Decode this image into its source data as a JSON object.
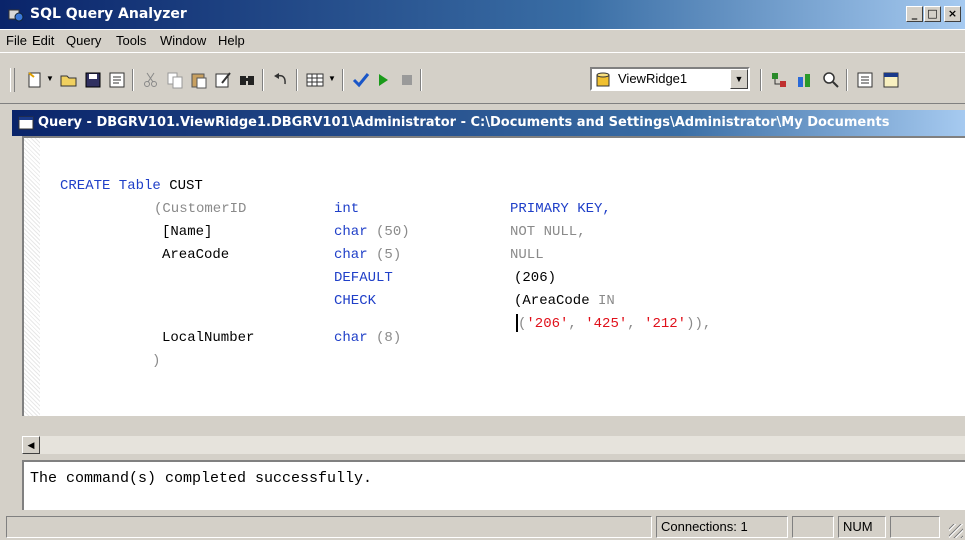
{
  "window": {
    "title": "SQL Query Analyzer",
    "minimize": "_",
    "maximize": "□",
    "close": "×"
  },
  "menu": [
    "File",
    "Edit",
    "Query",
    "Tools",
    "Window",
    "Help"
  ],
  "toolbar": {
    "database": "ViewRidge1",
    "icons": [
      "new-query-icon",
      "open-icon",
      "save-icon",
      "load-script-icon",
      "cut-icon",
      "copy-icon",
      "paste-icon",
      "clear-window-icon",
      "find-icon",
      "undo-icon",
      "results-mode-icon",
      "parse-icon",
      "execute-icon",
      "stop-icon",
      "database-icon",
      "object-browser-icon",
      "object-search-icon",
      "show-plan-icon",
      "properties-icon",
      "show-results-pane-icon"
    ]
  },
  "child_window": {
    "title": "Query - DBGRV101.ViewRidge1.DBGRV101\\Administrator - C:\\Documents and Settings\\Administrator\\My Documents"
  },
  "editor": {
    "lines": {
      "l1_kw": "CREATE Table",
      "l1_rest": " CUST",
      "c_customer": "(CustomerID",
      "c_name": "[Name]",
      "c_areacode": "AreaCode",
      "c_local": "LocalNumber",
      "c_close": ")",
      "t_int": "int",
      "t_char50_kw": "char",
      "t_char50_num": " (50)",
      "t_char5_kw": "char",
      "t_char5_num": " (5)",
      "t_default": "DEFAULT",
      "t_check": "CHECK",
      "t_char8_kw": "char",
      "t_char8_num": " (8)",
      "k_primary": "PRIMARY KEY,",
      "k_notnull": "NOT NULL,",
      "k_null": "NULL",
      "k_default_val": "(206)",
      "k_check_1a": "(AreaCode",
      "k_check_1b": " IN",
      "k_check_2_open": "(",
      "k_v1": "'206'",
      "k_sep1": ", ",
      "k_v2": "'425'",
      "k_sep2": ", ",
      "k_v3": "'212'",
      "k_check_2_close": ")),"
    }
  },
  "results": {
    "message": "The command(s) completed successfully."
  },
  "status": {
    "connections": "Connections: 1",
    "num": "NUM"
  }
}
